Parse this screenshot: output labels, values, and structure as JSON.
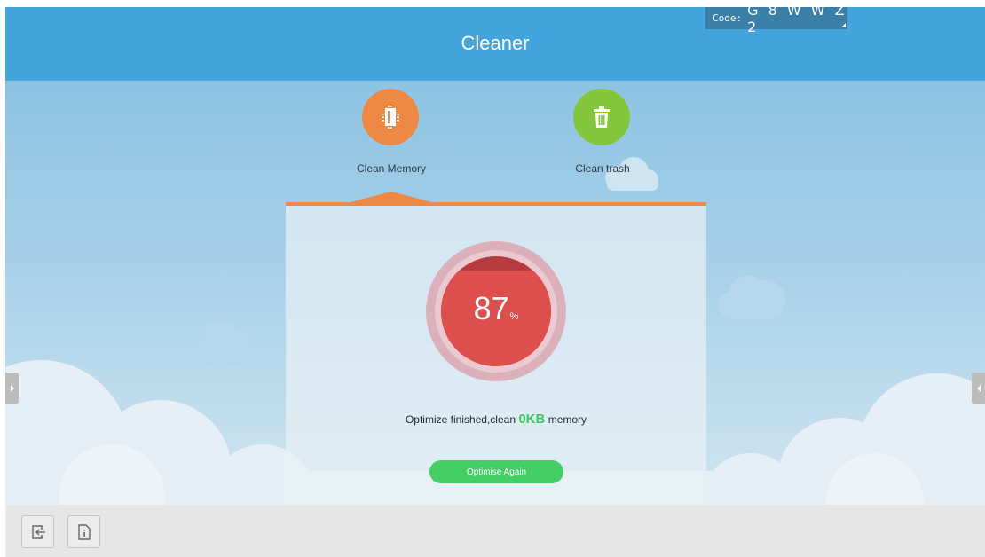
{
  "header": {
    "title": "Cleaner",
    "code_label": "Code:",
    "code_value": "G 8 W W Z 2"
  },
  "tabs": [
    {
      "label": "Clean Memory",
      "icon": "memory-chip-icon",
      "color": "#ED8944",
      "selected": true
    },
    {
      "label": "Clean trash",
      "icon": "trash-can-icon",
      "color": "#84C63B",
      "selected": false
    }
  ],
  "gauge": {
    "value": "87",
    "unit": "%",
    "fill_fraction": 0.87
  },
  "status": {
    "prefix": "Optimize finished,clean",
    "amount": "0KB",
    "suffix": "memory"
  },
  "actions": {
    "optimise_label": "Optimise Again"
  },
  "bottom_bar": {
    "buttons": [
      {
        "icon": "exit-icon"
      },
      {
        "icon": "info-icon"
      }
    ]
  },
  "colors": {
    "header": "#44A4DC",
    "accent": "#ED8944",
    "gauge": "#DC4F4D",
    "success": "#45CD66"
  }
}
